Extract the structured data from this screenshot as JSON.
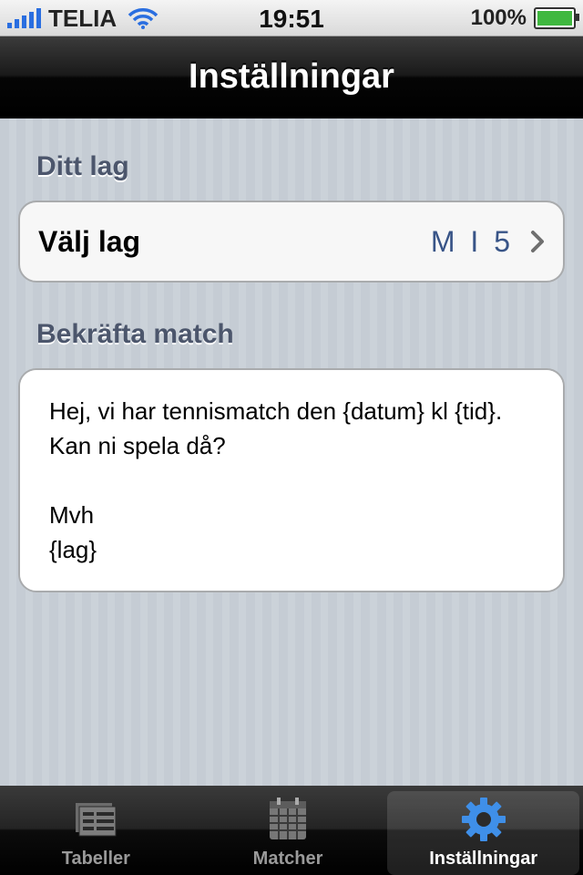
{
  "status_bar": {
    "carrier": "TELIA",
    "time": "19:51",
    "battery": "100%"
  },
  "nav": {
    "title": "Inställningar"
  },
  "sections": {
    "team_header": "Ditt lag",
    "team_label": "Välj lag",
    "team_value": "M I 5",
    "confirm_header": "Bekräfta match",
    "message_lines": [
      "Hej, vi har tennismatch den {datum} kl {tid}.",
      "Kan ni spela då?",
      "",
      "Mvh",
      "{lag}"
    ]
  },
  "tabs": [
    {
      "label": "Tabeller",
      "icon": "tables-icon"
    },
    {
      "label": "Matcher",
      "icon": "calendar-icon"
    },
    {
      "label": "Inställningar",
      "icon": "gear-icon"
    }
  ],
  "colors": {
    "accent_blue": "#2f7de1",
    "value_blue": "#385487",
    "header_text": "#4c566c"
  }
}
